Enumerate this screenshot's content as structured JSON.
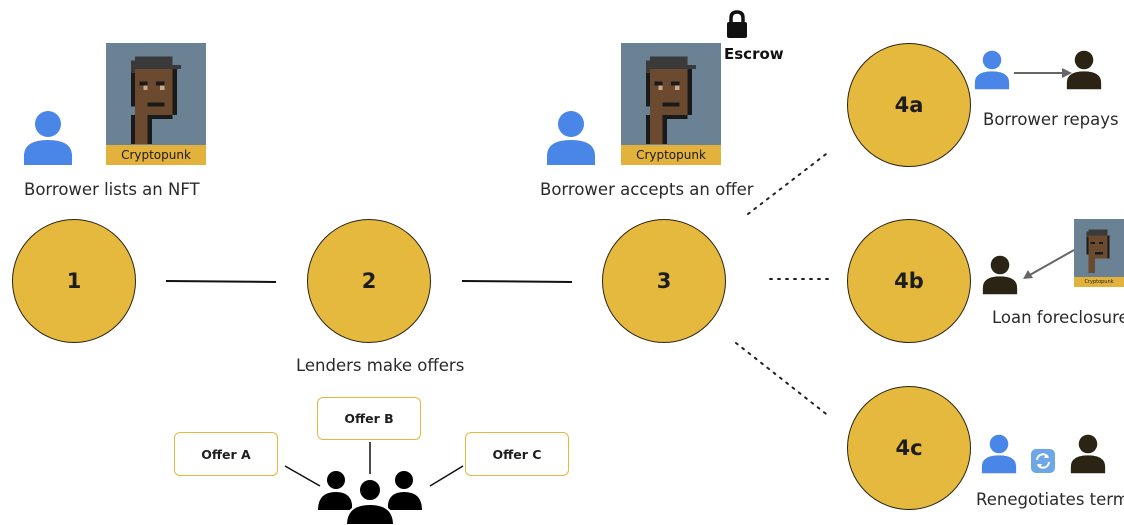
{
  "steps": {
    "s1": "1",
    "s2": "2",
    "s3": "3",
    "s4a": "4a",
    "s4b": "4b",
    "s4c": "4c"
  },
  "captions": {
    "lists": "Borrower lists an NFT",
    "offers": "Lenders make offers",
    "accepts": "Borrower accepts an offer",
    "repays": "Borrower repays",
    "foreclosure": "Loan foreclosure",
    "renegotiates": "Renegotiates terms"
  },
  "escrow_label": "Escrow",
  "nft_label": "Cryptopunk",
  "nft_label_small": "Cryptopunk",
  "offers": [
    "Offer A",
    "Offer B",
    "Offer C"
  ],
  "colors": {
    "node": "#e5b83e",
    "borrower": "#4a86e8",
    "lender": "#2b2415",
    "nft_bg": "#6a8293"
  },
  "icons": [
    "user-icon",
    "cryptopunk-image",
    "lock-icon",
    "arrow-icon",
    "lenders-group-icon",
    "swap-icon"
  ]
}
